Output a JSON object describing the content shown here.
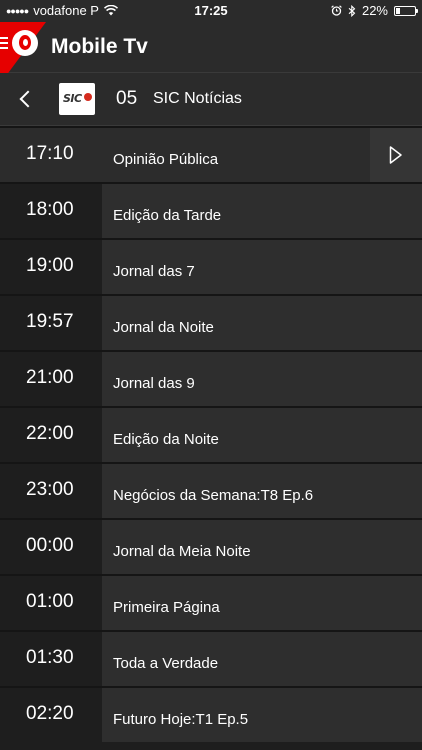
{
  "status_bar": {
    "signal_dots": "●●●●●",
    "carrier": "vodafone P",
    "wifi_icon": "wifi-icon",
    "time": "17:25",
    "alarm_icon": "alarm-clock-icon",
    "bluetooth_icon": "bluetooth-icon",
    "battery_percent": "22%",
    "battery_level": 0.22
  },
  "header": {
    "title": "Mobile Tv",
    "accent_color": "#e60000",
    "menu_icon": "hamburger-menu-icon",
    "logo": "vodafone-logo"
  },
  "channel": {
    "number": "05",
    "name": "SIC Notícias",
    "logo_text": "SIC",
    "back_icon": "chevron-left-icon"
  },
  "schedule": [
    {
      "time": "17:10",
      "title": "Opinião Pública",
      "current": true
    },
    {
      "time": "18:00",
      "title": "Edição da Tarde",
      "current": false
    },
    {
      "time": "19:00",
      "title": "Jornal das 7",
      "current": false
    },
    {
      "time": "19:57",
      "title": "Jornal da Noite",
      "current": false
    },
    {
      "time": "21:00",
      "title": "Jornal das 9",
      "current": false
    },
    {
      "time": "22:00",
      "title": "Edição da Noite",
      "current": false
    },
    {
      "time": "23:00",
      "title": "Negócios da Semana:T8 Ep.6",
      "current": false
    },
    {
      "time": "00:00",
      "title": "Jornal da Meia Noite",
      "current": false
    },
    {
      "time": "01:00",
      "title": "Primeira Página",
      "current": false
    },
    {
      "time": "01:30",
      "title": "Toda a Verdade",
      "current": false
    },
    {
      "time": "02:20",
      "title": "Futuro Hoje:T1 Ep.5",
      "current": false
    }
  ]
}
